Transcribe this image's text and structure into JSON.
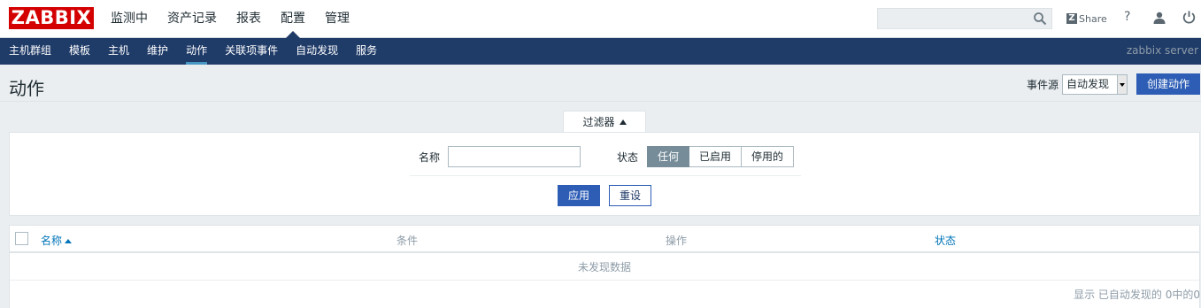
{
  "app": {
    "logo": "ZABBIX",
    "server_name": "zabbix server"
  },
  "main_menu": [
    {
      "label": "监测中"
    },
    {
      "label": "资产记录"
    },
    {
      "label": "报表"
    },
    {
      "label": "配置",
      "active": true
    },
    {
      "label": "管理"
    }
  ],
  "topbar": {
    "search_placeholder": "",
    "share_label": "Share",
    "help_label": "?"
  },
  "sub_menu": [
    {
      "label": "主机群组"
    },
    {
      "label": "模板"
    },
    {
      "label": "主机"
    },
    {
      "label": "维护"
    },
    {
      "label": "动作",
      "active": true
    },
    {
      "label": "关联项事件"
    },
    {
      "label": "自动发现"
    },
    {
      "label": "服务"
    }
  ],
  "header": {
    "title": "动作",
    "event_source_label": "事件源",
    "event_source_value": "自动发现",
    "create_button": "创建动作"
  },
  "filter": {
    "tab_label": "过滤器",
    "name_label": "名称",
    "name_value": "",
    "status_label": "状态",
    "status_options": [
      "任何",
      "已启用",
      "停用的"
    ],
    "status_selected": "任何",
    "apply_button": "应用",
    "reset_button": "重设"
  },
  "table": {
    "columns": {
      "name": "名称",
      "conditions": "条件",
      "operations": "操作",
      "status": "状态"
    },
    "rows": [],
    "empty_text": "未发现数据",
    "paging_text": "显示 已自动发现的 0中的0"
  },
  "colors": {
    "logo_red": "#d40000",
    "nav_blue": "#1f3b68",
    "primary_button": "#2d5db5",
    "link_blue": "#0275b8",
    "selected_segment": "#768d99"
  }
}
